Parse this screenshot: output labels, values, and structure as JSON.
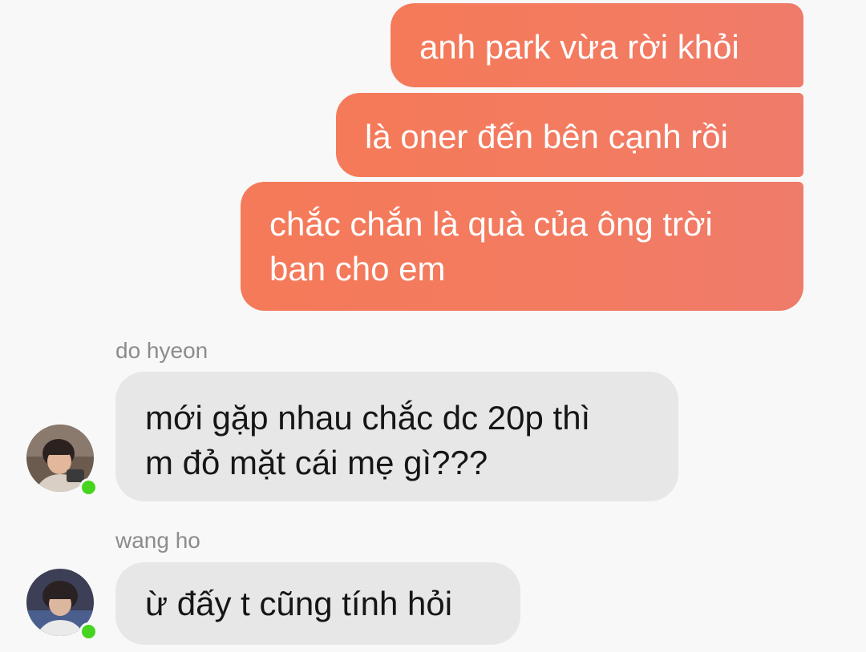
{
  "conversation": {
    "outgoing": [
      {
        "text": "anh park vừa rời khỏi"
      },
      {
        "text": "là oner đến bên cạnh rồi"
      },
      {
        "text": "chắc chắn là quà của ông trời\nban cho em"
      }
    ],
    "incoming": [
      {
        "sender": "do hyeon",
        "text": "mới gặp nhau chắc dc 20p thì\nm đỏ mặt cái mẹ gì???",
        "online": true
      },
      {
        "sender": "wang ho",
        "text": "ừ đấy t cũng tính hỏi",
        "online": true
      }
    ]
  },
  "colors": {
    "outgoing_bubble": "#f47a5e",
    "incoming_bubble": "#e7e7e7",
    "online_status": "#47d41f",
    "sender_name": "#8c8c8c"
  },
  "icons": {
    "status": "online-status-icon"
  }
}
